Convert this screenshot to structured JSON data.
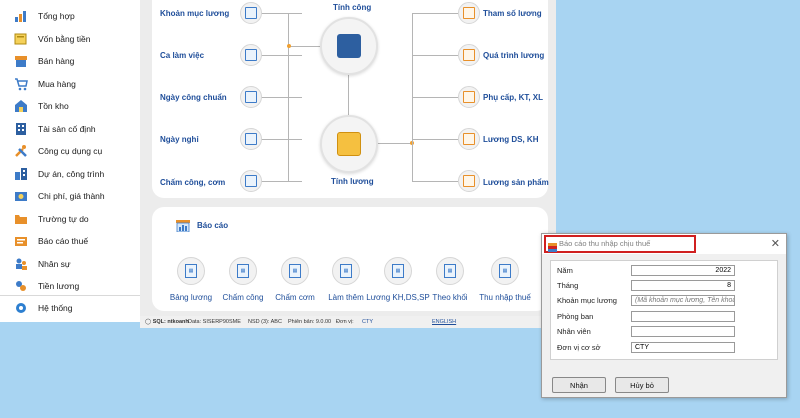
{
  "sidebar": {
    "items": [
      {
        "label": "Tổng hợp",
        "icon": "bar-chart-icon"
      },
      {
        "label": "Vốn bằng tiền",
        "icon": "money-book-icon"
      },
      {
        "label": "Bán hàng",
        "icon": "shop-icon"
      },
      {
        "label": "Mua hàng",
        "icon": "cart-icon"
      },
      {
        "label": "Tồn kho",
        "icon": "warehouse-icon"
      },
      {
        "label": "Tài sản cố định",
        "icon": "fixed-asset-icon"
      },
      {
        "label": "Công cụ dụng cụ",
        "icon": "tools-icon"
      },
      {
        "label": "Dự án, công trình",
        "icon": "building-icon"
      },
      {
        "label": "Chi phí, giá thành",
        "icon": "cost-icon"
      },
      {
        "label": "Trường tự do",
        "icon": "folder-icon"
      },
      {
        "label": "Báo cáo thuế",
        "icon": "tax-report-icon"
      },
      {
        "label": "Nhân sự",
        "icon": "people-icon"
      },
      {
        "label": "Tiền lương",
        "icon": "salary-icon"
      },
      {
        "label": "Hệ thống",
        "icon": "gear-icon"
      }
    ]
  },
  "flow": {
    "left_nodes": [
      "Khoản mục lương",
      "Ca làm việc",
      "Ngày công chuẩn",
      "Ngày nghỉ",
      "Chấm công, cơm"
    ],
    "right_nodes": [
      "Tham số lương",
      "Quá trình lương",
      "Phụ cấp, KT, XL",
      "Lương DS, KH",
      "Lương sản phẩm"
    ],
    "hub_top": "Tính công",
    "hub_bottom": "Tính lương"
  },
  "reports": {
    "title": "Báo cáo",
    "items": [
      "Bảng lương",
      "Chấm công",
      "Chấm cơm",
      "Làm thêm",
      "Lương KH,DS,SP",
      "Theo khối",
      "Thu nhập thuế"
    ]
  },
  "statusbar": {
    "sql": "SQL: ntkoanh",
    "data": "Data: SISERP90SME",
    "nsd": "NSD (3): ABC",
    "version": "Phiên bản: 9.0.00",
    "unit_label": "Đơn vị:",
    "unit_value": "CTY",
    "language": "ENGLISH"
  },
  "dialog": {
    "title": "Báo cáo thu nhập chịu thuế",
    "close": "✕",
    "fields": [
      {
        "label": "Năm",
        "value": "2022"
      },
      {
        "label": "Tháng",
        "value": "8"
      },
      {
        "label": "Khoản mục lương",
        "placeholder": "(Mã khoản mục lương, Tên khoản mục lương)"
      },
      {
        "label": "Phòng ban",
        "value": ""
      },
      {
        "label": "Nhân viên",
        "value": ""
      },
      {
        "label": "Đơn vị cơ sở",
        "value": "CTY"
      }
    ],
    "ok_label": "Nhận",
    "cancel_label": "Hủy bỏ"
  },
  "colors": {
    "accent": "#1f4e9a",
    "highlight_border": "#d02020",
    "connector_dot": "#f0a030"
  }
}
